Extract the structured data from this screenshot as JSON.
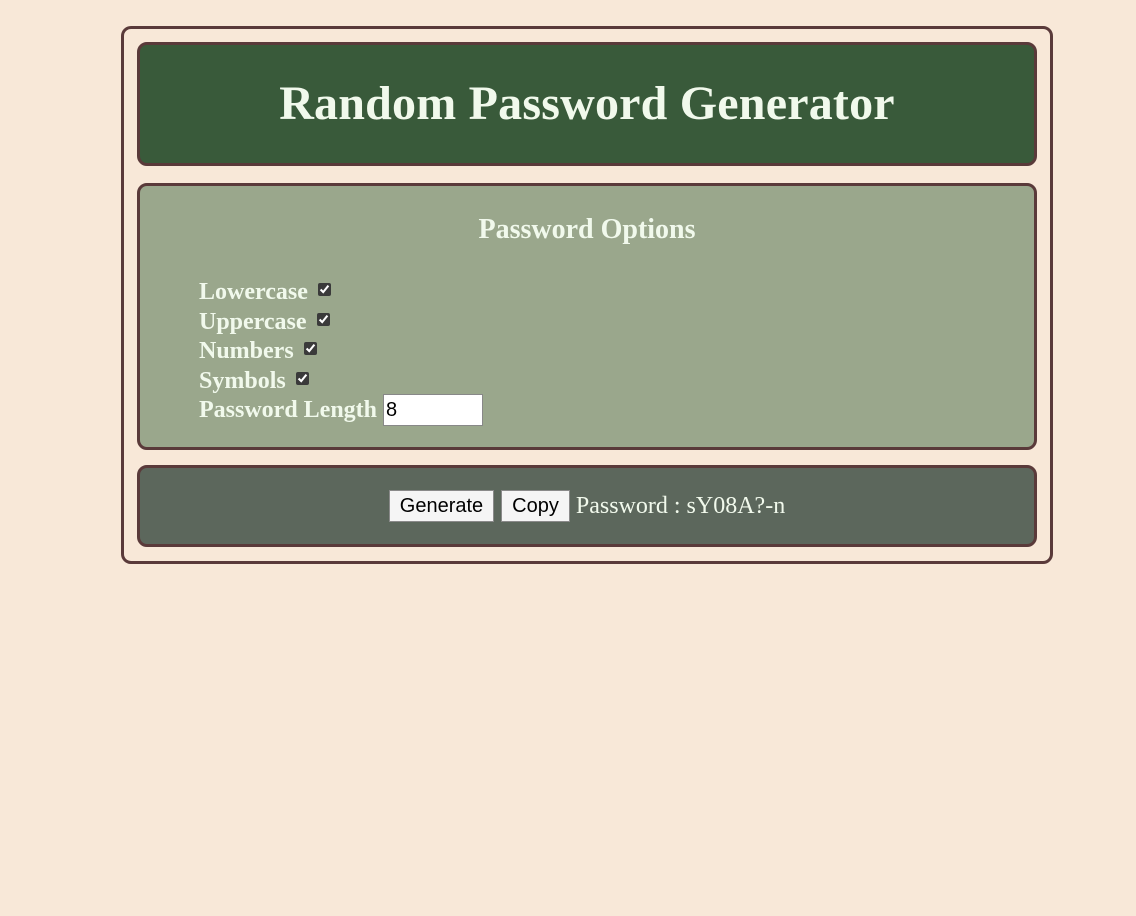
{
  "app": {
    "title": "Random Password Generator"
  },
  "options": {
    "heading": "Password Options",
    "items": [
      {
        "label": "Lowercase",
        "checked": true
      },
      {
        "label": "Uppercase",
        "checked": true
      },
      {
        "label": "Numbers",
        "checked": true
      },
      {
        "label": "Symbols",
        "checked": true
      }
    ],
    "length_label": "Password Length",
    "length_value": "8"
  },
  "result": {
    "generate_label": "Generate",
    "copy_label": "Copy",
    "password_prefix": "Password : ",
    "password_value": "sY08A?-n"
  },
  "colors": {
    "background": "#f8e8d8",
    "header": "#395a3a",
    "options": "#9aa78c",
    "result": "#5c675c",
    "border": "#5a3a3a",
    "text": "#f1f9ec"
  }
}
